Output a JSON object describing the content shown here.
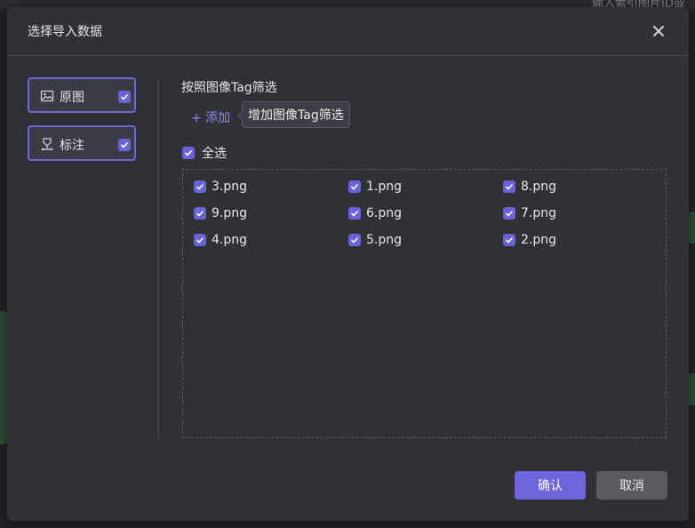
{
  "background": {
    "search_hint": "输入索引图片ID或",
    "colors": {
      "page": "#202124",
      "strip": "#2a2b30",
      "deco": "#2f4a37"
    }
  },
  "dialog": {
    "title": "选择导入数据",
    "close_icon": "close-icon",
    "sources": [
      {
        "label": "原图",
        "icon": "image-icon",
        "checked": true
      },
      {
        "label": "标注",
        "icon": "annotation-icon",
        "checked": true
      }
    ],
    "filter": {
      "title": "按照图像Tag筛选",
      "add_label": "+ 添加",
      "tooltip": "增加图像Tag筛选"
    },
    "select_all": {
      "label": "全选",
      "checked": true
    },
    "files": [
      {
        "name": "3.png",
        "checked": true
      },
      {
        "name": "1.png",
        "checked": true
      },
      {
        "name": "8.png",
        "checked": true
      },
      {
        "name": "9.png",
        "checked": true
      },
      {
        "name": "6.png",
        "checked": true
      },
      {
        "name": "7.png",
        "checked": true
      },
      {
        "name": "4.png",
        "checked": true
      },
      {
        "name": "5.png",
        "checked": true
      },
      {
        "name": "2.png",
        "checked": true
      }
    ],
    "buttons": {
      "confirm": "确认",
      "cancel": "取消"
    },
    "colors": {
      "accent": "#6e64dc",
      "panel": "#303136",
      "link": "#8f86f0"
    }
  }
}
